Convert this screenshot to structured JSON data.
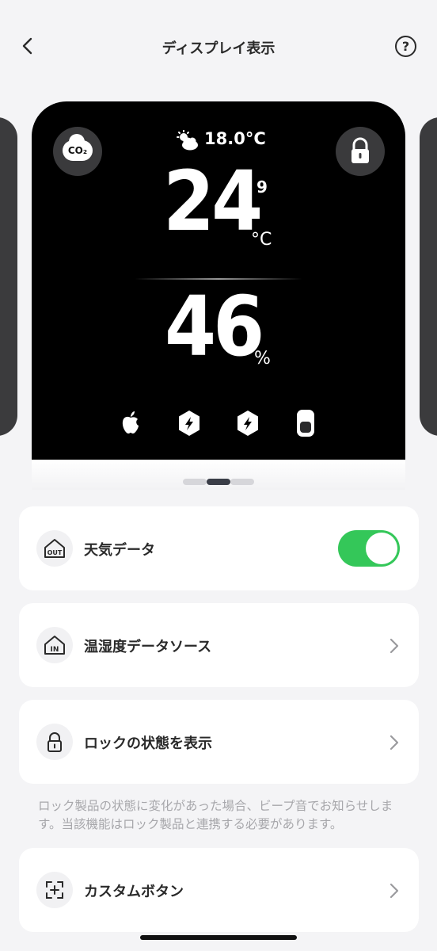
{
  "header": {
    "title": "ディスプレイ表示",
    "back_icon": "chevron-left-icon",
    "help_label": "?"
  },
  "display": {
    "co2_label": "CO₂",
    "weather_temp": "18.0°C",
    "temp_int": "24",
    "temp_dec": "9",
    "temp_unit": "°C",
    "humidity": "46",
    "humidity_unit": "%",
    "device_icons": [
      "apple-icon",
      "bolt-hex-icon",
      "bolt-hex-icon",
      "switch-device-icon"
    ]
  },
  "pager": {
    "count": 3,
    "active_index": 1
  },
  "settings": {
    "weather": {
      "label": "天気データ",
      "icon_text": "OUT",
      "enabled": true
    },
    "source": {
      "label": "温湿度データソース",
      "icon_text": "IN"
    },
    "lock": {
      "label": "ロックの状態を表示"
    },
    "note": "ロック製品の状態に変化があった場合、ビープ音でお知らせします。当該機能はロック製品と連携する必要があります。",
    "custom": {
      "label": "カスタムボタン"
    }
  },
  "colors": {
    "toggle_on": "#34c759",
    "background": "#f4f4f6"
  }
}
